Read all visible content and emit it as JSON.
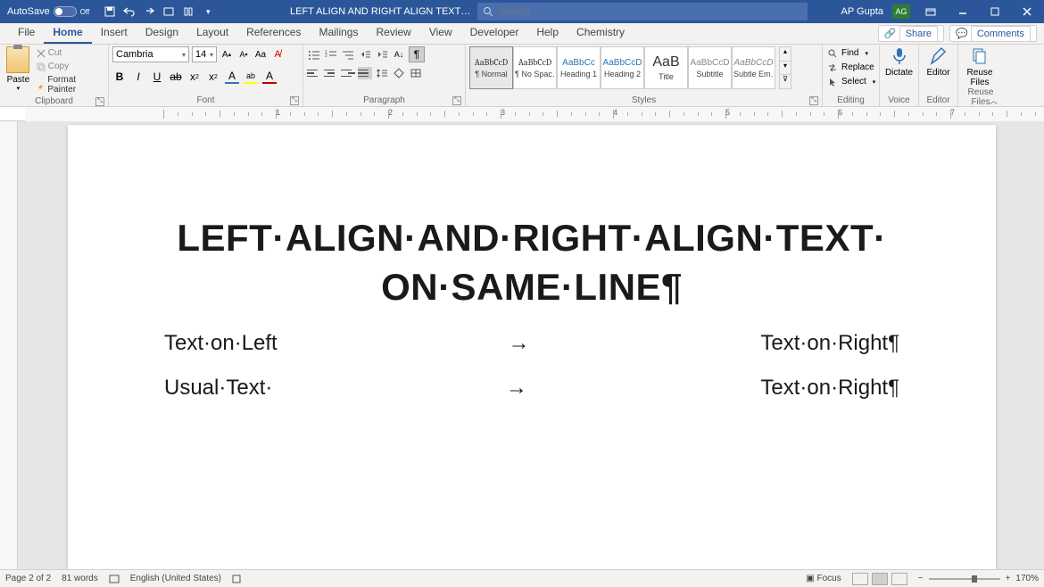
{
  "titlebar": {
    "autosave_label": "AutoSave",
    "autosave_state": "Off",
    "doc_name": "LEFT ALIGN AND RIGHT ALIGN TEXT…",
    "search_placeholder": "Search",
    "user_name": "AP Gupta",
    "user_initials": "AG"
  },
  "tabs": {
    "items": [
      "File",
      "Home",
      "Insert",
      "Design",
      "Layout",
      "References",
      "Mailings",
      "Review",
      "View",
      "Developer",
      "Help",
      "Chemistry"
    ],
    "active_index": 1,
    "share": "Share",
    "comments": "Comments"
  },
  "ribbon": {
    "clipboard": {
      "paste": "Paste",
      "cut": "Cut",
      "copy": "Copy",
      "format_painter": "Format Painter",
      "label": "Clipboard"
    },
    "font": {
      "name": "Cambria",
      "size": "14",
      "label": "Font",
      "buttons": {
        "bold": "B",
        "italic": "I",
        "underline": "U",
        "strike": "ab",
        "sub": "x",
        "sup": "x",
        "fontcolor": "A",
        "highlight": "ab",
        "casebtn": "Aa",
        "clear": "A"
      }
    },
    "paragraph": {
      "label": "Paragraph"
    },
    "styles": {
      "label": "Styles",
      "items": [
        {
          "preview": "AaBbCcD",
          "label": "¶ Normal",
          "active": true,
          "font_serif": true
        },
        {
          "preview": "AaBbCcD",
          "label": "¶ No Spac…",
          "font_serif": true
        },
        {
          "preview": "AaBbCc",
          "label": "Heading 1",
          "color": "#2e74b5"
        },
        {
          "preview": "AaBbCcD",
          "label": "Heading 2",
          "color": "#2e74b5"
        },
        {
          "preview": "AaB",
          "label": "Title",
          "big": true
        },
        {
          "preview": "AaBbCcD",
          "label": "Subtitle",
          "color": "#888"
        },
        {
          "preview": "AaBbCcD",
          "label": "Subtle Em…",
          "italic": true,
          "color": "#888"
        }
      ]
    },
    "editing": {
      "find": "Find",
      "replace": "Replace",
      "select": "Select",
      "label": "Editing"
    },
    "voice": {
      "dictate": "Dictate",
      "label": "Voice"
    },
    "editor": {
      "editor": "Editor",
      "label": "Editor"
    },
    "reuse": {
      "reuse": "Reuse Files",
      "label": "Reuse Files"
    }
  },
  "ruler": {
    "numbers": [
      "1",
      "2",
      "3",
      "4",
      "5",
      "6",
      "7"
    ]
  },
  "document": {
    "heading_line1": "LEFT·ALIGN·AND·RIGHT·ALIGN·TEXT·",
    "heading_line2": "ON·SAME·LINE¶",
    "rows": [
      {
        "left": "Text·on·Left",
        "arrow": "→",
        "right": "Text·on·Right¶"
      },
      {
        "left": "Usual·Text·",
        "arrow": "→",
        "right": "Text·on·Right¶"
      }
    ]
  },
  "statusbar": {
    "page": "Page 2 of 2",
    "words": "81 words",
    "lang": "English (United States)",
    "focus": "Focus",
    "zoom": "170%"
  }
}
